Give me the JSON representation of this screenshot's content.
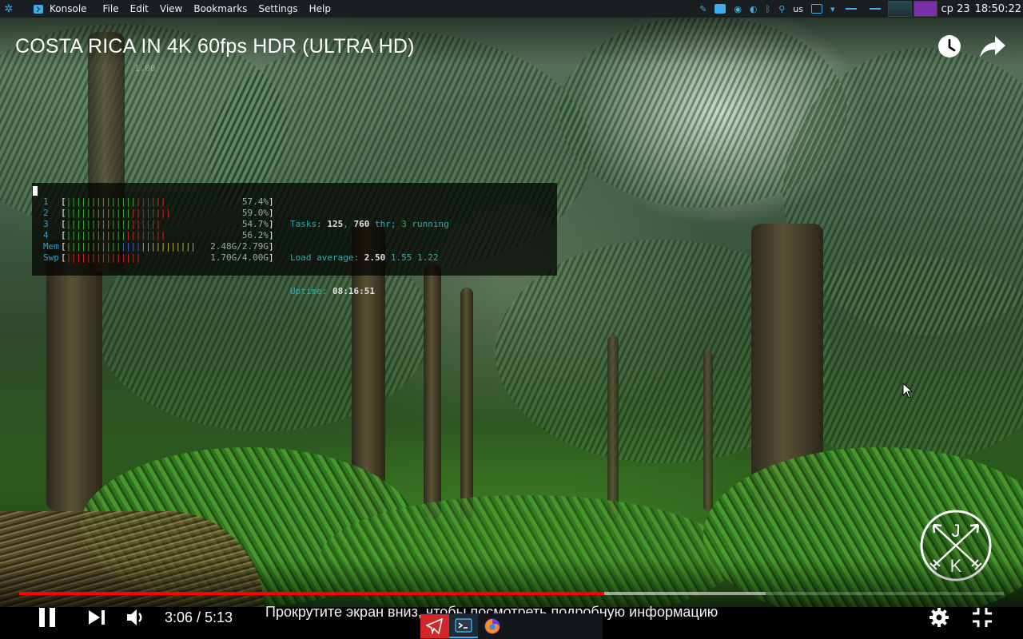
{
  "panel": {
    "app_name": "Konsole",
    "menu": [
      "File",
      "Edit",
      "View",
      "Bookmarks",
      "Settings",
      "Help"
    ],
    "keyboard_layout": "us",
    "date": "ср 23",
    "time": "18:50:22"
  },
  "video": {
    "title": "COSTA RICA IN 4K 60fps HDR (ULTRA HD)",
    "current_time": "3:06",
    "duration": "5:13",
    "time_display": "3:06 / 5:13",
    "played_fraction": 0.594,
    "buffered_fraction": 0.758,
    "hint": "Прокрутите экран вниз, чтобы посмотреть подробную информацию",
    "channel_logo_letters": [
      "J",
      "K"
    ],
    "accent_color": "#ff0000"
  },
  "htop": {
    "cpus": [
      {
        "label": "1",
        "percent": "57.4%"
      },
      {
        "label": "2",
        "percent": "59.0%"
      },
      {
        "label": "3",
        "percent": "54.7%"
      },
      {
        "label": "4",
        "percent": "56.2%"
      }
    ],
    "mem": {
      "label": "Mem",
      "value": "2.48G/2.79G"
    },
    "swap": {
      "label": "Swp",
      "value": "1.70G/4.00G"
    },
    "tasks_label": "Tasks:",
    "tasks": "125",
    "threads": "760",
    "threads_label": "thr;",
    "running": "3",
    "running_label": "running",
    "load_label": "Load average:",
    "load1": "2.50",
    "load5": "1.55",
    "load15": "1.22",
    "uptime_label": "Uptime:",
    "uptime": "08:16:51"
  },
  "ghost_text": "1.00",
  "taskbar": {
    "items": [
      "telegram-icon",
      "konsole-icon",
      "firefox-icon"
    ]
  }
}
